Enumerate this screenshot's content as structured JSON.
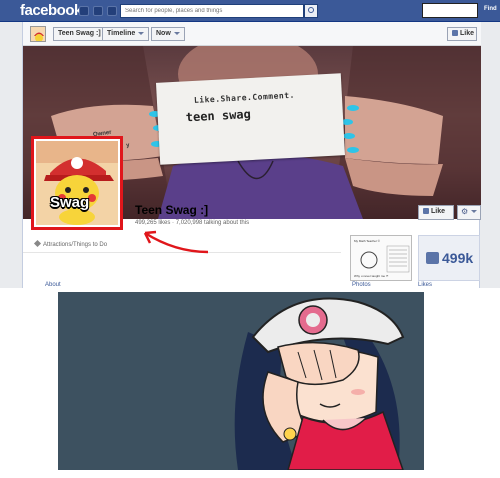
{
  "topbar": {
    "logo": "facebook",
    "search_placeholder": "Search for people, places and things",
    "find_label": "Find"
  },
  "page_header": {
    "page_selector": "Teen Swag :]",
    "timeline_label": "Timeline",
    "now_label": "Now",
    "like_label": "Like"
  },
  "cover": {
    "card_line1": "Like.Share.Comment.",
    "card_line2": "teen swag",
    "hand_text1": "Owner",
    "hand_text2": "R o y"
  },
  "profile": {
    "picture_label": "Swag",
    "name": "Teen Swag :]",
    "stats": "499,265 likes · 7,020,998 talking about this",
    "like_label": "Like",
    "category": "Attractions/Things to Do"
  },
  "sidebar": {
    "photo_title": "My Math Teacher ©",
    "photo_caption": "Why u never taught me ?!",
    "likes_count": "499k"
  },
  "tabs": {
    "about": "About",
    "photos": "Photos",
    "likes": "Likes"
  },
  "colors": {
    "facebook_blue": "#3b5998",
    "highlight_red": "#e0161b"
  }
}
